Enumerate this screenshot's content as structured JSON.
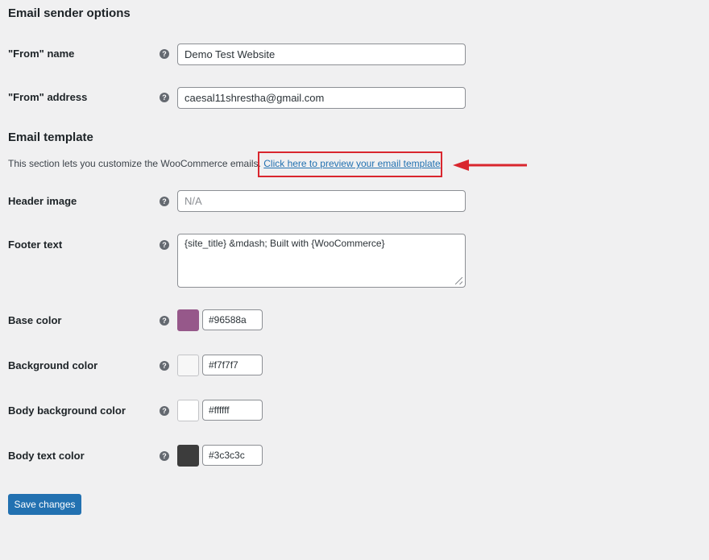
{
  "sender": {
    "title": "Email sender options",
    "from_name_label": "\"From\" name",
    "from_name_value": "Demo Test Website",
    "from_address_label": "\"From\" address",
    "from_address_value": "caesal11shrestha@gmail.com"
  },
  "template": {
    "title": "Email template",
    "description": "This section lets you customize the WooCommerce emails.",
    "preview_link": "Click here to preview your email template",
    "preview_link_suffix": ".",
    "header_image_label": "Header image",
    "header_image_placeholder": "N/A",
    "footer_text_label": "Footer text",
    "footer_text_value": "{site_title} &mdash; Built with {WooCommerce}",
    "base_color_label": "Base color",
    "base_color_value": "#96588a",
    "background_color_label": "Background color",
    "background_color_value": "#f7f7f7",
    "body_background_color_label": "Body background color",
    "body_background_color_value": "#ffffff",
    "body_text_color_label": "Body text color",
    "body_text_color_value": "#3c3c3c"
  },
  "help_icon": "question-circle-icon",
  "save_button": "Save changes",
  "colors": {
    "accent": "#2271b1",
    "annotation": "#d9262e",
    "base_swatch": "#96588a",
    "background_swatch": "#f7f7f7",
    "body_background_swatch": "#ffffff",
    "body_text_swatch": "#3c3c3c"
  }
}
